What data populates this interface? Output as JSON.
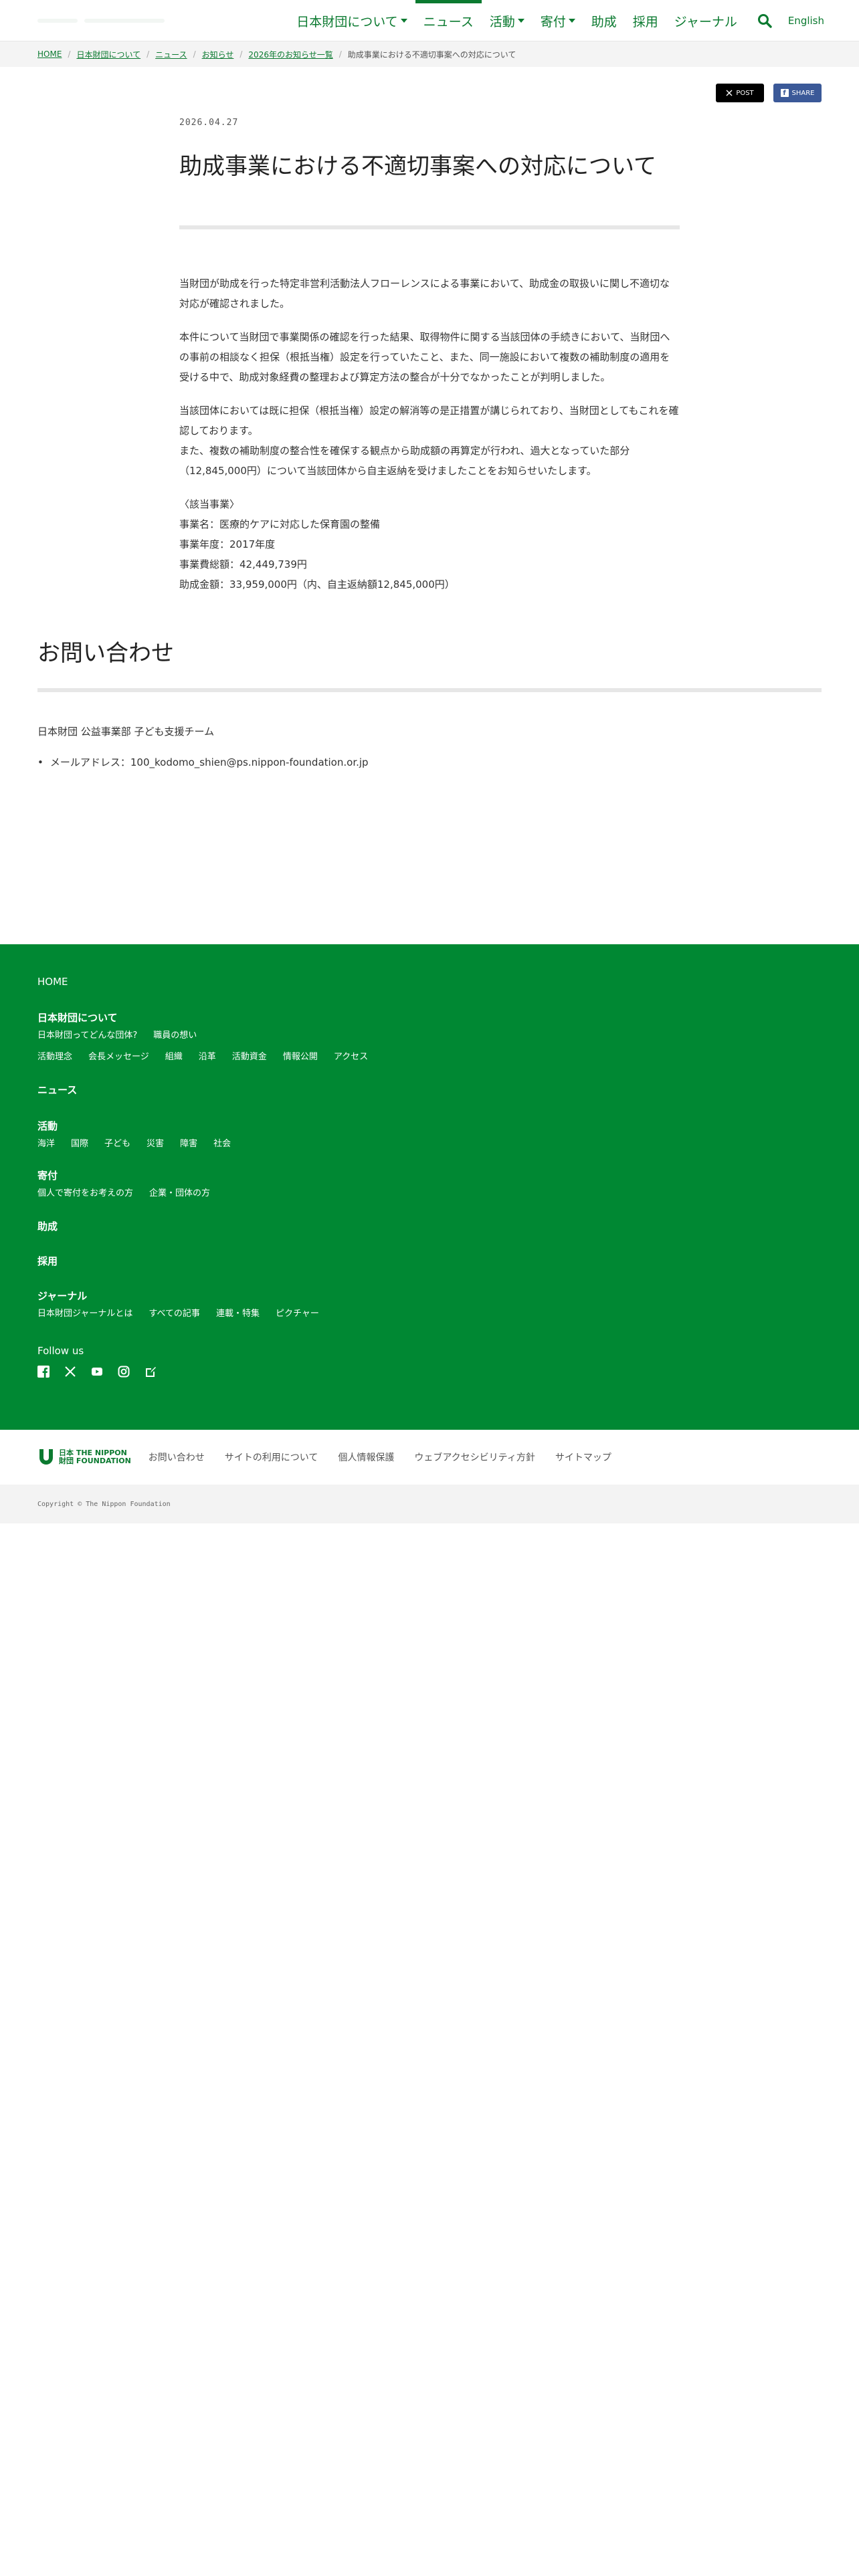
{
  "header": {
    "nav": [
      {
        "label": "日本財団について",
        "dropdown": true,
        "current": false
      },
      {
        "label": "ニュース",
        "dropdown": false,
        "current": true
      },
      {
        "label": "活動",
        "dropdown": true,
        "current": false
      },
      {
        "label": "寄付",
        "dropdown": true,
        "current": false
      },
      {
        "label": "助成",
        "dropdown": false,
        "current": false
      },
      {
        "label": "採用",
        "dropdown": false,
        "current": false
      },
      {
        "label": "ジャーナル",
        "dropdown": false,
        "current": false
      }
    ],
    "search_icon": "search-icon",
    "lang_label": "English"
  },
  "breadcrumb": {
    "links": [
      "HOME",
      "日本財団について",
      "ニュース",
      "お知らせ",
      "2026年のお知らせ一覧"
    ],
    "current": "助成事業における不適切事案への対応について"
  },
  "share": {
    "post_label": "POST",
    "share_label": "SHARE"
  },
  "article": {
    "date": "2026.04.27",
    "title": "助成事業における不適切事案への対応について",
    "paragraphs": [
      "当財団が助成を行った特定非営利活動法人フローレンスによる事業において、助成金の取扱いに関し不適切な対応が確認されました。",
      "本件について当財団で事業関係の確認を行った結果、取得物件に関する当該団体の手続きにおいて、当財団への事前の相談なく担保（根抵当権）設定を行っていたこと、また、同一施設において複数の補助制度の適用を受ける中で、助成対象経費の整理および算定方法の整合が十分でなかったことが判明しました。",
      "当該団体においては既に担保（根抵当権）設定の解消等の是正措置が講じられており、当財団としてもこれを確認しております。",
      "また、複数の補助制度の整合性を確保する観点から助成額の再算定が行われ、過大となっていた部分（12,845,000円）について当該団体から自主返納を受けましたことをお知らせいたします。"
    ],
    "details": [
      "〈該当事業〉",
      "事業名：医療的ケアに対応した保育園の整備",
      "事業年度：2017年度",
      "事業費総額：42,449,739円",
      "助成金額：33,959,000円（内、自主返納額12,845,000円）"
    ]
  },
  "contact": {
    "heading": "お問い合わせ",
    "team": "日本財団 公益事業部 子ども支援チーム",
    "items": [
      "メールアドレス：100_kodomo_shien@ps.nippon-foundation.or.jp"
    ]
  },
  "footer": {
    "home": "HOME",
    "about": {
      "title": "日本財団について",
      "row1": [
        "日本財団ってどんな団体?",
        "職員の想い"
      ],
      "row2": [
        "活動理念",
        "会長メッセージ",
        "組織",
        "沿革",
        "活動資金",
        "情報公開",
        "アクセス"
      ]
    },
    "news": "ニュース",
    "activities": {
      "title": "活動",
      "links": [
        "海洋",
        "国際",
        "子ども",
        "災害",
        "障害",
        "社会"
      ]
    },
    "donate": {
      "title": "寄付",
      "links": [
        "個人で寄付をお考えの方",
        "企業・団体の方"
      ]
    },
    "grants": "助成",
    "recruit": "採用",
    "journal": {
      "title": "ジャーナル",
      "links": [
        "日本財団ジャーナルとは",
        "すべての記事",
        "連載・特集",
        "ピクチャー"
      ]
    },
    "follow_label": "Follow us",
    "sns": [
      "facebook-icon",
      "x-icon",
      "youtube-icon",
      "instagram-icon",
      "note-icon"
    ],
    "logo_text_1": "日本 THE NIPPON",
    "logo_text_2": "財団 FOUNDATION",
    "util_links": [
      "お問い合わせ",
      "サイトの利用について",
      "個人情報保護",
      "ウェブアクセシビリティ方針",
      "サイトマップ"
    ],
    "copyright": "Copyright © The Nippon Foundation"
  },
  "colors": {
    "brand_green": "#008833",
    "link_green": "#0b7a30",
    "x_black": "#000000",
    "facebook_blue": "#3b5998"
  }
}
